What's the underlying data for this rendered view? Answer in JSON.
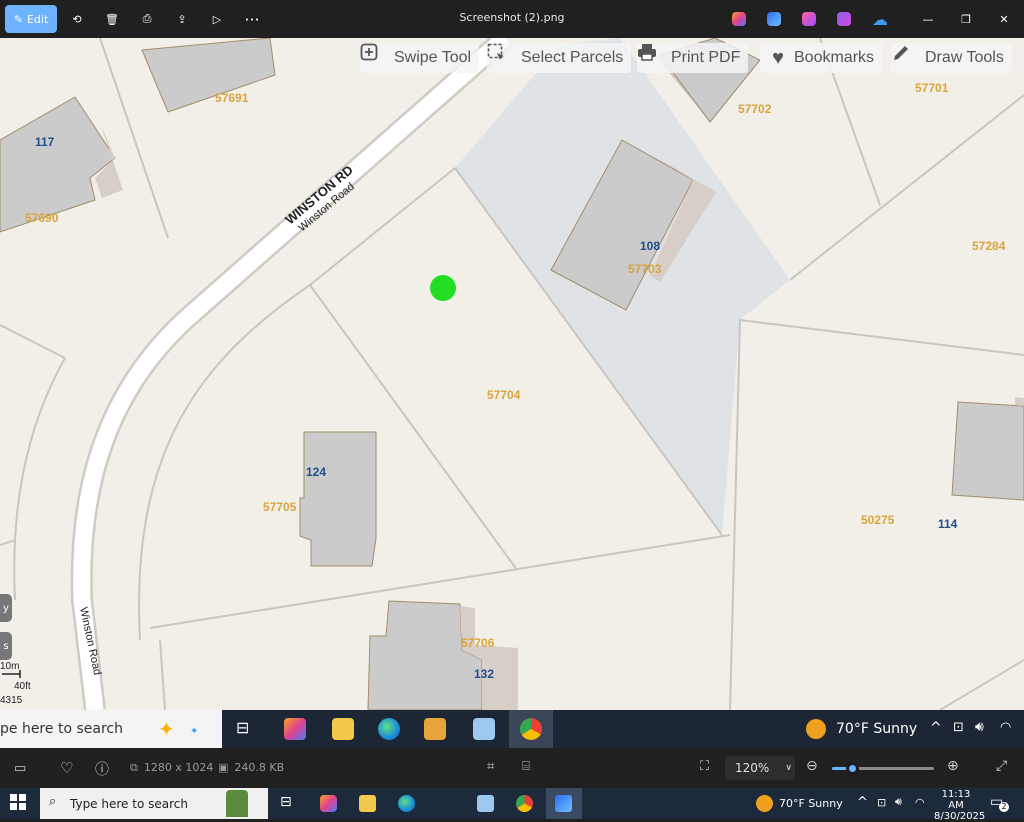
{
  "viewer": {
    "edit_label": "Edit",
    "title": "Screenshot (2).png",
    "dimensions": "1280 x 1024",
    "file_size": "240.8 KB",
    "zoom": "120%",
    "zoom_fraction": 0.2
  },
  "map_toolbar": {
    "swipe": "Swipe Tool",
    "select": "Select Parcels",
    "print": "Print PDF",
    "bookmarks": "Bookmarks",
    "draw": "Draw Tools"
  },
  "map": {
    "road_label_1": "WINSTON RD",
    "road_label_2": "Winston Road",
    "road_label_3": "Winston Road",
    "parcel_ids": {
      "p57691": "57691",
      "p57690": "57690",
      "p57702": "57702",
      "p57701": "57701",
      "p57703": "57703",
      "p57284": "57284",
      "p57704": "57704",
      "p57705": "57705",
      "p50275": "50275",
      "p57706": "57706"
    },
    "house_numbers": {
      "h117": "117",
      "h108": "108",
      "h124": "124",
      "h114": "114",
      "h132": "132"
    },
    "marker_color": "#22dd22",
    "scale_m": "10m",
    "scale_ft": "40ft",
    "scale_num": "4315"
  },
  "inner_taskbar": {
    "search_text": "pe here to search",
    "weather": "70°F  Sunny"
  },
  "taskbar": {
    "search_text": "Type here to search",
    "weather": "70°F  Sunny",
    "time": "11:13 AM",
    "date": "8/30/2025",
    "notification_count": "2"
  }
}
